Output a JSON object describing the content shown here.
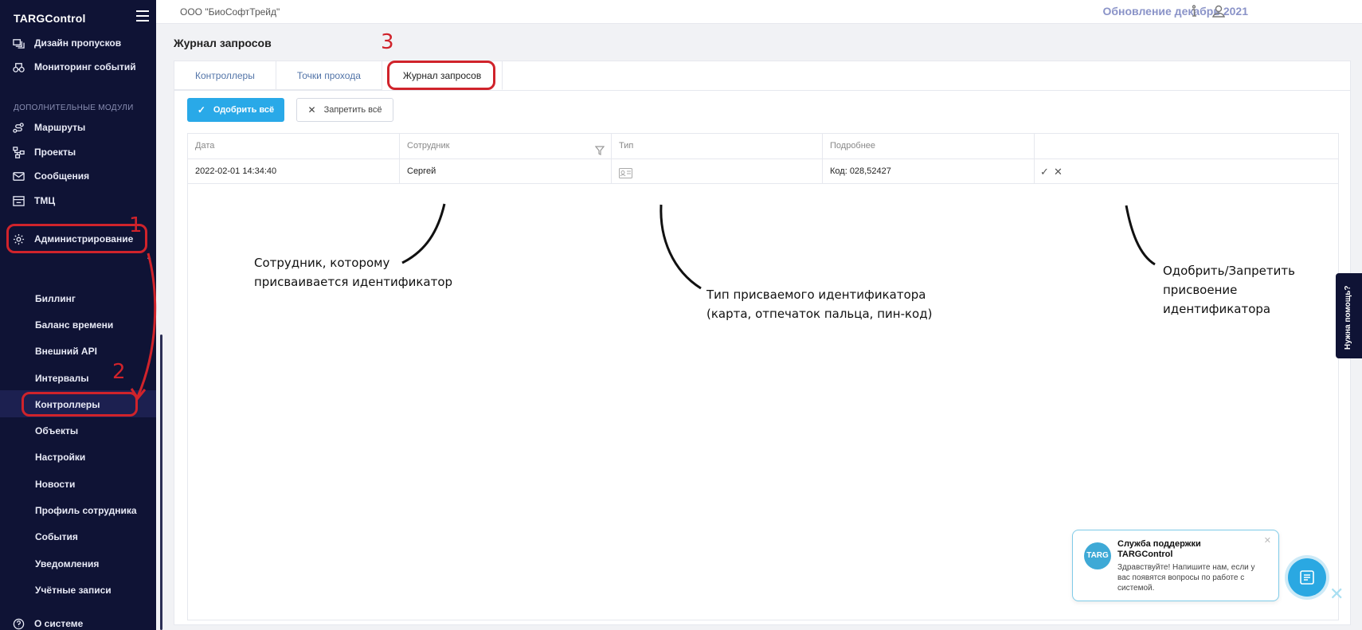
{
  "brand": "TARGControl",
  "sidebar": {
    "top_items": [
      {
        "label": "Дизайн пропусков",
        "icon": "badge-design-icon"
      },
      {
        "label": "Мониторинг событий",
        "icon": "monitoring-icon"
      }
    ],
    "section_label": "ДОПОЛНИТЕЛЬНЫЕ МОДУЛИ",
    "module_items": [
      {
        "label": "Маршруты",
        "icon": "routes-icon"
      },
      {
        "label": "Проекты",
        "icon": "projects-icon"
      },
      {
        "label": "Сообщения",
        "icon": "mail-icon"
      },
      {
        "label": "ТМЦ",
        "icon": "inventory-icon"
      }
    ],
    "admin": {
      "label": "Администрирование",
      "icon": "gear-icon"
    },
    "admin_items": [
      "Биллинг",
      "Баланс времени",
      "Внешний API",
      "Интервалы",
      "Контроллеры",
      "Объекты",
      "Настройки",
      "Новости",
      "Профиль сотрудника",
      "События",
      "Уведомления",
      "Учётные записи"
    ],
    "bottom_item": {
      "label": "О системе",
      "icon": "help-circle-icon"
    }
  },
  "topbar": {
    "org": "ООО \"БиоСофтТрейд\"",
    "update_link": "Обновление декабрь 2021"
  },
  "page": {
    "title": "Журнал запросов",
    "tabs": [
      "Контроллеры",
      "Точки прохода",
      "Журнал запросов"
    ],
    "active_tab": "Журнал запросов",
    "approve_all": "Одобрить всё",
    "deny_all": "Запретить всё"
  },
  "table": {
    "columns": [
      "Дата",
      "Сотрудник",
      "Тип",
      "Подробнее",
      ""
    ],
    "rows": [
      {
        "date": "2022-02-01 14:34:40",
        "employee": "Сергей",
        "type_icon": "id-card-icon",
        "details": "Код: 028,52427"
      }
    ]
  },
  "annotations": {
    "num1": "1",
    "num2": "2",
    "num3": "3",
    "employee_note": [
      "Сотрудник, которому",
      "присваивается идентификатор"
    ],
    "type_note": [
      "Тип присваемого идентификатора",
      "(карта, отпечаток пальца, пин-код)"
    ],
    "action_note": [
      "Одобрить/Запретить",
      "присвоение",
      "идентификатора"
    ]
  },
  "help_tab": "Нужна помощь?",
  "chat": {
    "logo": "TARG",
    "title": "Служба поддержки TARGControl",
    "body": "Здравствуйте! Напишите нам, если у вас появятся вопросы по работе с системой."
  },
  "colors": {
    "sidebar_bg": "#0f1335",
    "accent": "#29a9e8",
    "annotation_red": "#d0232b"
  }
}
